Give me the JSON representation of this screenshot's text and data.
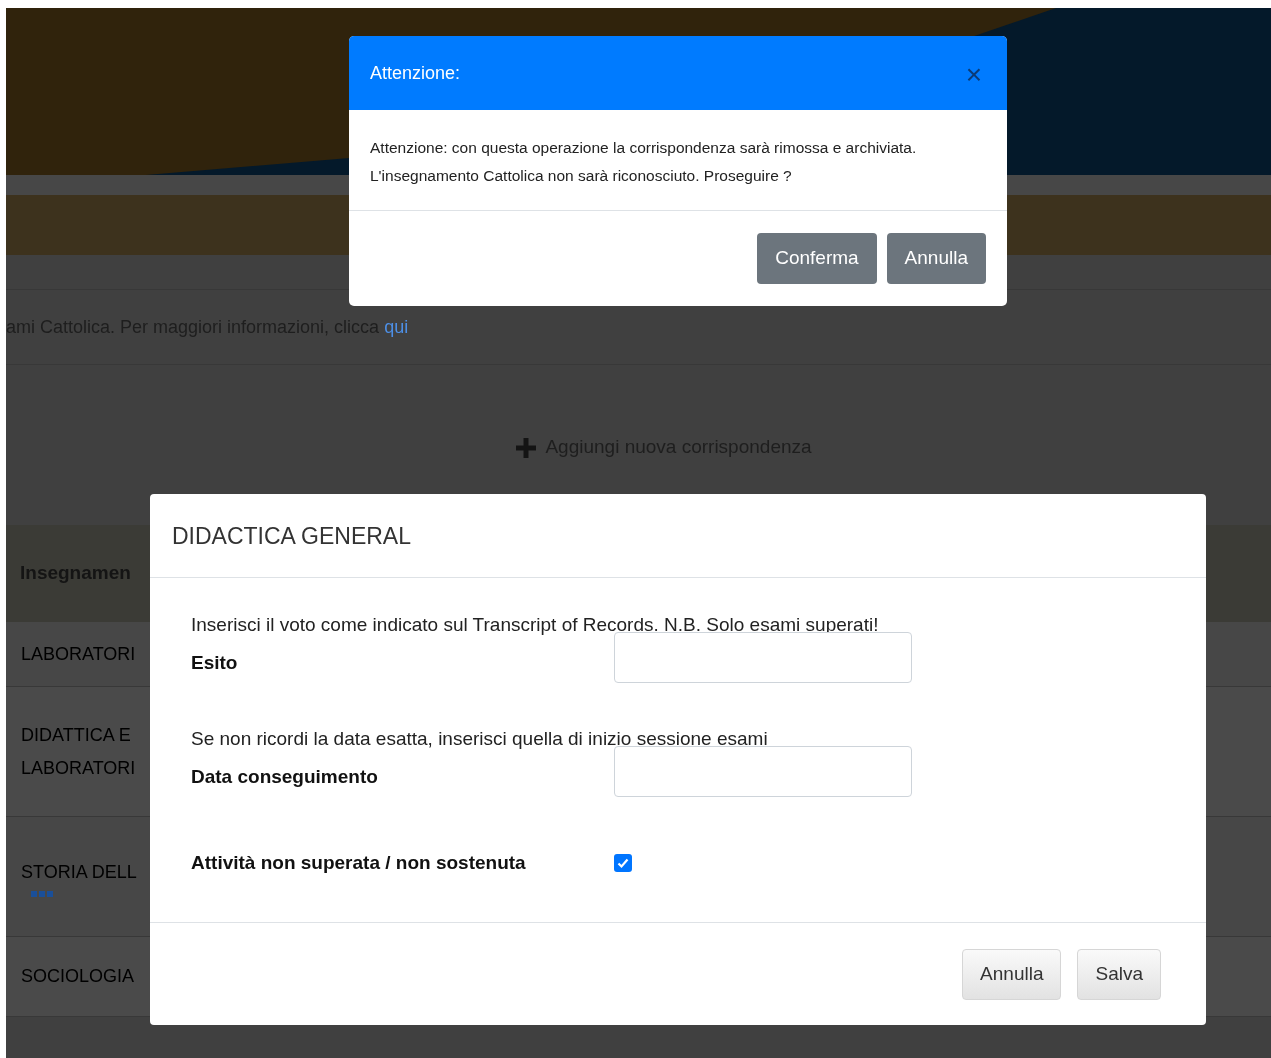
{
  "page": {
    "info_text": "ami Cattolica. Per maggiori informazioni, clicca ",
    "info_link": "qui",
    "add_button": "Aggiungi nuova corrispondenza",
    "table": {
      "header": "Insegnamen",
      "rows": [
        {
          "lines": [
            "LABORATORI"
          ],
          "more": false
        },
        {
          "lines": [
            "DIDATTICA E",
            "LABORATORI"
          ],
          "more": false
        },
        {
          "lines": [
            "STORIA DELL"
          ],
          "more": true
        },
        {
          "lines": [
            "SOCIOLOGIA"
          ],
          "more": false
        }
      ]
    }
  },
  "confirm_dialog": {
    "title": "Attenzione:",
    "close": "×",
    "message": "Attenzione: con questa operazione la corrispondenza sarà rimossa e archiviata. L'insegnamento Cattolica non sarà riconosciuto. Proseguire ?",
    "buttons": [
      "Conferma",
      "Annulla"
    ]
  },
  "grade_dialog": {
    "title": "DIDACTICA GENERAL",
    "fields": [
      {
        "kind": "note",
        "text": "Inserisci il voto come indicato sul Transcript of Records. N.B. Solo esami superati!"
      },
      {
        "kind": "input",
        "label": "Esito"
      },
      {
        "kind": "note",
        "text": "Se non ricordi la data esatta, inserisci quella di inizio sessione esami"
      },
      {
        "kind": "input",
        "label": "Data conseguimento"
      },
      {
        "kind": "checkbox",
        "label": "Attività non superata / non sostenuta",
        "checked": true
      }
    ],
    "buttons": [
      "Annulla",
      "Salva"
    ]
  }
}
